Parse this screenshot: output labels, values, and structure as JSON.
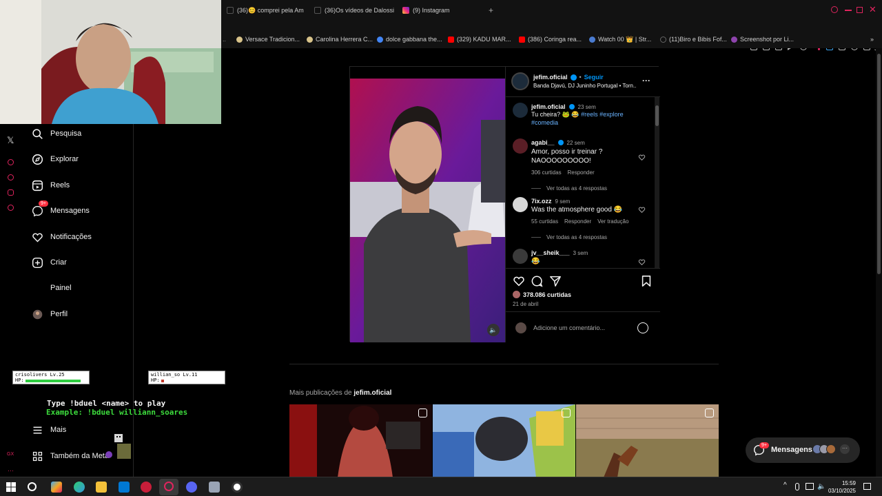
{
  "browser": {
    "tabs": [
      {
        "label": "(36)😊 comprei pela Am"
      },
      {
        "label": "(36)Os vídeos de Dalossi"
      },
      {
        "label": "(9) Instagram"
      }
    ],
    "new_tab": "+",
    "bookmarks": [
      {
        "label": "Versace Tradicion..."
      },
      {
        "label": "Carolina Herrera C..."
      },
      {
        "label": "dolce gabbana the..."
      },
      {
        "label": "(329) KADU MAR..."
      },
      {
        "label": "(386) Coringa rea..."
      },
      {
        "label": "Watch 00 👑 | Str..."
      },
      {
        "label": "(11)Biro e Bibis Fof..."
      },
      {
        "label": "Screenshot por Li..."
      }
    ]
  },
  "sidebar": {
    "items": [
      {
        "label": "Pesquisa",
        "icon": "search-icon"
      },
      {
        "label": "Explorar",
        "icon": "compass-icon"
      },
      {
        "label": "Reels",
        "icon": "reels-icon"
      },
      {
        "label": "Mensagens",
        "icon": "messenger-icon",
        "badge": "9+"
      },
      {
        "label": "Notificações",
        "icon": "heart-icon"
      },
      {
        "label": "Criar",
        "icon": "plus-square-icon"
      },
      {
        "label": "Painel",
        "icon": "dashboard-icon"
      },
      {
        "label": "Perfil",
        "icon": "profile-avatar"
      }
    ],
    "more": "Mais",
    "also_meta": "Também da Meta"
  },
  "overlay": {
    "player1": "crisolivers",
    "player1_level": "Lv.25",
    "player2": "willian_so",
    "player2_level": "Lv.11",
    "hp": "HP:",
    "line1": "Type !bduel <name> to play",
    "line2": "Example: !bduel williann_soares"
  },
  "post": {
    "username": "jefim.oficial",
    "follow": "Seguir",
    "audio": "Banda Djavú, DJ Juninho Portugal • Torn...",
    "caption": {
      "user": "jefim.oficial",
      "time": "23 sem",
      "text": "Tu cheira? 🐸 😂",
      "tags1": "#reels #explore",
      "tags2": "#comedia"
    },
    "comments": [
      {
        "user": "agabi__",
        "time": "22 sem",
        "text": "Amor, posso ir treinar ? NAOOOOOOOOO!",
        "likes": "306 curtidas",
        "reply": "Responder",
        "view_replies": "Ver todas as 4 respostas"
      },
      {
        "user": "7ix.ozz",
        "time": "9 sem",
        "text": "Was the atmosphere good 😂",
        "likes": "55 curtidas",
        "reply": "Responder",
        "translate": "Ver tradução",
        "view_replies": "Ver todas as 4 respostas"
      },
      {
        "user": "jv__sheik___",
        "time": "3 sem",
        "text": "😂"
      }
    ],
    "likes": "378.086 curtidas",
    "date": "21 de abril",
    "comment_placeholder": "Adicione um comentário..."
  },
  "more_posts": {
    "prefix": "Mais publicações de",
    "user": "jefim.oficial"
  },
  "messages_pill": {
    "label": "Mensagens",
    "badge": "9+"
  },
  "taskbar": {
    "time": "15:59",
    "date": "03/10/2025"
  },
  "colors": {
    "accent": "#0095f6",
    "badge": "#ff3040",
    "bg": "#000000"
  }
}
